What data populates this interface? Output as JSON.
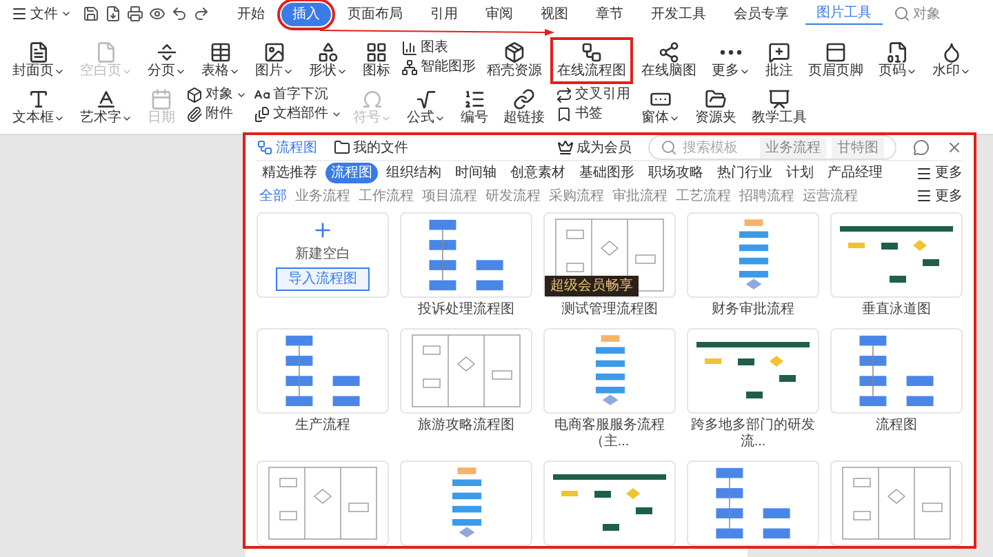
{
  "menu_bar": {
    "file_menu": "文件",
    "tabs": [
      {
        "label": "开始",
        "selected": false,
        "highlighted": false
      },
      {
        "label": "插入",
        "selected": true,
        "highlighted": true
      },
      {
        "label": "页面布局",
        "selected": false,
        "highlighted": false
      },
      {
        "label": "引用",
        "selected": false,
        "highlighted": false
      },
      {
        "label": "审阅",
        "selected": false,
        "highlighted": false
      },
      {
        "label": "视图",
        "selected": false,
        "highlighted": false
      },
      {
        "label": "章节",
        "selected": false,
        "highlighted": false
      },
      {
        "label": "开发工具",
        "selected": false,
        "highlighted": false
      },
      {
        "label": "会员专享",
        "selected": false,
        "highlighted": false
      }
    ],
    "context_tab": "图片工具",
    "search": "对象"
  },
  "ribbon": [
    {
      "kind": "large",
      "label": "封面页",
      "dropdown": true,
      "disabled": false,
      "highlighted": false
    },
    {
      "kind": "large",
      "label": "空白页",
      "dropdown": true,
      "disabled": true,
      "highlighted": false
    },
    {
      "kind": "large",
      "label": "分页",
      "dropdown": true,
      "disabled": false,
      "highlighted": false
    },
    {
      "kind": "large",
      "label": "表格",
      "dropdown": true,
      "disabled": false,
      "highlighted": false
    },
    {
      "kind": "large",
      "label": "图片",
      "dropdown": true,
      "disabled": false,
      "highlighted": false
    },
    {
      "kind": "large",
      "label": "形状",
      "dropdown": true,
      "disabled": false,
      "highlighted": false
    },
    {
      "kind": "large",
      "label": "图标",
      "dropdown": false,
      "disabled": false,
      "highlighted": false
    },
    {
      "kind": "stack",
      "items": [
        {
          "label": "图表",
          "dropdown": false,
          "disabled": false
        },
        {
          "label": "智能图形",
          "dropdown": false,
          "disabled": false
        }
      ]
    },
    {
      "kind": "large",
      "label": "稻壳资源",
      "dropdown": false,
      "disabled": false,
      "highlighted": false
    },
    {
      "kind": "large",
      "label": "在线流程图",
      "dropdown": false,
      "disabled": false,
      "highlighted": true
    },
    {
      "kind": "large",
      "label": "在线脑图",
      "dropdown": false,
      "disabled": false,
      "highlighted": false
    },
    {
      "kind": "large",
      "label": "更多",
      "dropdown": true,
      "disabled": false,
      "highlighted": false
    },
    {
      "kind": "large",
      "label": "批注",
      "dropdown": false,
      "disabled": false,
      "highlighted": false
    },
    {
      "kind": "large",
      "label": "页眉页脚",
      "dropdown": false,
      "disabled": false,
      "highlighted": false
    },
    {
      "kind": "large",
      "label": "页码",
      "dropdown": true,
      "disabled": false,
      "highlighted": false
    },
    {
      "kind": "large",
      "label": "水印",
      "dropdown": true,
      "disabled": false,
      "highlighted": false
    },
    {
      "kind": "large",
      "label": "文本框",
      "dropdown": true,
      "disabled": false,
      "highlighted": false
    },
    {
      "kind": "large",
      "label": "艺术字",
      "dropdown": true,
      "disabled": false,
      "highlighted": false
    },
    {
      "kind": "large",
      "label": "日期",
      "dropdown": false,
      "disabled": true,
      "highlighted": false
    },
    {
      "kind": "stack",
      "items": [
        {
          "label": "对象",
          "dropdown": true,
          "disabled": false
        },
        {
          "label": "附件",
          "dropdown": false,
          "disabled": false
        }
      ]
    },
    {
      "kind": "stack",
      "items": [
        {
          "label": "首字下沉",
          "dropdown": false,
          "disabled": false
        },
        {
          "label": "文档部件",
          "dropdown": true,
          "disabled": false
        }
      ]
    },
    {
      "kind": "large",
      "label": "符号",
      "dropdown": true,
      "disabled": true,
      "highlighted": false
    },
    {
      "kind": "large",
      "label": "公式",
      "dropdown": true,
      "disabled": false,
      "highlighted": false
    },
    {
      "kind": "large",
      "label": "编号",
      "dropdown": false,
      "disabled": false,
      "highlighted": false
    },
    {
      "kind": "large",
      "label": "超链接",
      "dropdown": false,
      "disabled": false,
      "highlighted": false
    },
    {
      "kind": "stack",
      "items": [
        {
          "label": "交叉引用",
          "dropdown": false,
          "disabled": false
        },
        {
          "label": "书签",
          "dropdown": false,
          "disabled": false
        }
      ]
    },
    {
      "kind": "large",
      "label": "窗体",
      "dropdown": true,
      "disabled": false,
      "highlighted": false
    },
    {
      "kind": "large",
      "label": "资源夹",
      "dropdown": false,
      "disabled": false,
      "highlighted": false
    },
    {
      "kind": "large",
      "label": "教学工具",
      "dropdown": false,
      "disabled": false,
      "highlighted": false
    }
  ],
  "dialog": {
    "tabs": [
      {
        "label": "流程图",
        "selected": true
      },
      {
        "label": "我的文件",
        "selected": false
      }
    ],
    "member_link": "成为会员",
    "search": {
      "placeholder": "搜索模板",
      "tags": [
        "业务流程",
        "甘特图"
      ]
    },
    "categories": [
      {
        "label": "精选推荐",
        "selected": false
      },
      {
        "label": "流程图",
        "selected": true
      },
      {
        "label": "组织结构",
        "selected": false
      },
      {
        "label": "时间轴",
        "selected": false
      },
      {
        "label": "创意素材",
        "selected": false
      },
      {
        "label": "基础图形",
        "selected": false
      },
      {
        "label": "职场攻略",
        "selected": false
      },
      {
        "label": "热门行业",
        "selected": false
      },
      {
        "label": "计划",
        "selected": false
      },
      {
        "label": "产品经理",
        "selected": false
      }
    ],
    "categories_more": "更多",
    "subcategories": [
      {
        "label": "全部",
        "selected": true
      },
      {
        "label": "业务流程",
        "selected": false
      },
      {
        "label": "工作流程",
        "selected": false
      },
      {
        "label": "项目流程",
        "selected": false
      },
      {
        "label": "研发流程",
        "selected": false
      },
      {
        "label": "采购流程",
        "selected": false
      },
      {
        "label": "审批流程",
        "selected": false
      },
      {
        "label": "工艺流程",
        "selected": false
      },
      {
        "label": "招聘流程",
        "selected": false
      },
      {
        "label": "运营流程",
        "selected": false
      }
    ],
    "subcategories_more": "更多",
    "new_blank": {
      "label": "新建空白",
      "button": "导入流程图"
    },
    "templates": [
      {
        "kind": "titled",
        "title": "投诉处理流程图"
      },
      {
        "kind": "titled",
        "title": "测试管理流程图",
        "badge": "超级会员畅享"
      },
      {
        "kind": "titled",
        "title": "财务审批流程"
      },
      {
        "kind": "titled",
        "title": "垂直泳道图"
      },
      {
        "kind": "titled",
        "title": "生产流程"
      },
      {
        "kind": "titled",
        "title": "旅游攻略流程图"
      },
      {
        "kind": "titled",
        "title": "电商客服服务流程（主..."
      },
      {
        "kind": "titled",
        "title": "跨多地多部门的研发流..."
      },
      {
        "kind": "titled",
        "title": "流程图"
      },
      {
        "kind": "cut"
      },
      {
        "kind": "cut"
      },
      {
        "kind": "cut"
      },
      {
        "kind": "cut"
      },
      {
        "kind": "cut"
      }
    ]
  }
}
